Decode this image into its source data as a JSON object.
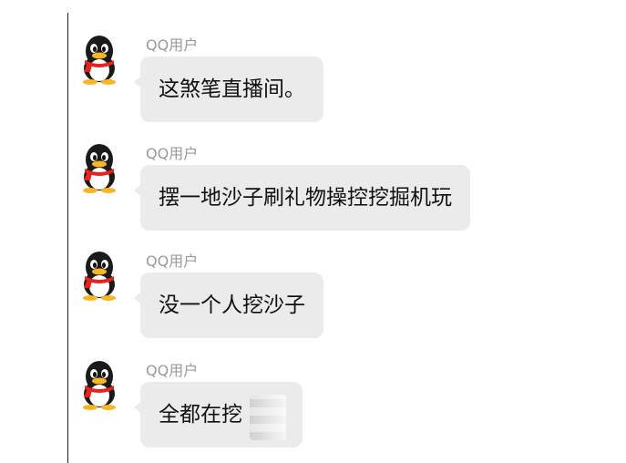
{
  "messages": [
    {
      "sender": "QQ用户",
      "text": "这煞笔直播间。"
    },
    {
      "sender": "QQ用户",
      "text": "摆一地沙子刷礼物操控挖掘机玩"
    },
    {
      "sender": "QQ用户",
      "text": "没一个人挖沙子"
    },
    {
      "sender": "QQ用户",
      "text": "全都在挖"
    }
  ],
  "avatar_icon": "qq-penguin-icon",
  "colors": {
    "bubble": "#ebebeb",
    "sender": "#9a9a9a",
    "scarf": "#e8231f",
    "beak": "#f6b626"
  }
}
